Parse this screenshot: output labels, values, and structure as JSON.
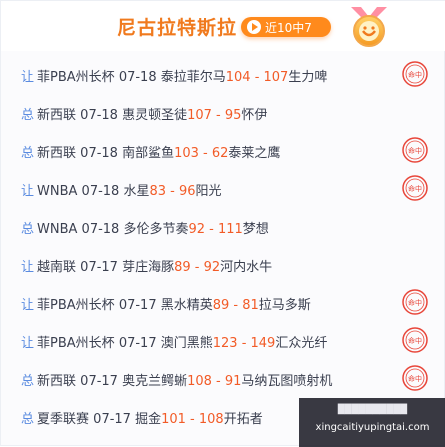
{
  "header": {
    "title": "尼古拉特斯拉",
    "pill_label": "近10中7"
  },
  "matches": [
    {
      "kind": "让",
      "league": "菲PBA州长杯",
      "date": "07-18",
      "home": "泰拉菲尔马",
      "score": "104 - 107",
      "away": "生力啤",
      "badge": true
    },
    {
      "kind": "总",
      "league": "新西联",
      "date": "07-18",
      "home": "惠灵顿圣徒",
      "score": "107 - 95",
      "away": "怀伊",
      "badge": false
    },
    {
      "kind": "总",
      "league": "新西联",
      "date": "07-18",
      "home": "南部鲨鱼",
      "score": "103 - 62",
      "away": "泰莱之鹰",
      "badge": true
    },
    {
      "kind": "让",
      "league": "WNBA",
      "date": "07-18",
      "home": "水星",
      "score": "83 - 96",
      "away": "阳光",
      "badge": true
    },
    {
      "kind": "总",
      "league": "WNBA",
      "date": "07-18",
      "home": "多伦多节奏",
      "score": "92 - 111",
      "away": "梦想",
      "badge": false
    },
    {
      "kind": "让",
      "league": "越南联",
      "date": "07-17",
      "home": "芽庄海豚",
      "score": "89 - 92",
      "away": "河内水牛",
      "badge": false
    },
    {
      "kind": "让",
      "league": "菲PBA州长杯",
      "date": "07-17",
      "home": "黑水精英",
      "score": "89 - 81",
      "away": "拉马多斯",
      "badge": true
    },
    {
      "kind": "让",
      "league": "菲PBA州长杯",
      "date": "07-17",
      "home": "澳门黑熊",
      "score": "123 - 149",
      "away": "汇众光纤",
      "badge": true
    },
    {
      "kind": "总",
      "league": "新西联",
      "date": "07-17",
      "home": "奥克兰鳄蜥",
      "score": "108 - 91",
      "away": "马纳瓦图喷射机",
      "badge": true
    },
    {
      "kind": "总",
      "league": "夏季联赛",
      "date": "07-17",
      "home": "掘金",
      "score": "101 - 108",
      "away": "开拓者",
      "badge": false
    }
  ],
  "badge_text": "命中",
  "overlay": {
    "line1": "██████████",
    "line2": "xingcaitiyupingtai.com"
  },
  "colors": {
    "title": "#f07a1e",
    "pill": "#ff8a1c",
    "score": "#f25b27",
    "kind": "#5a8be0",
    "badge": "#e8463a"
  }
}
